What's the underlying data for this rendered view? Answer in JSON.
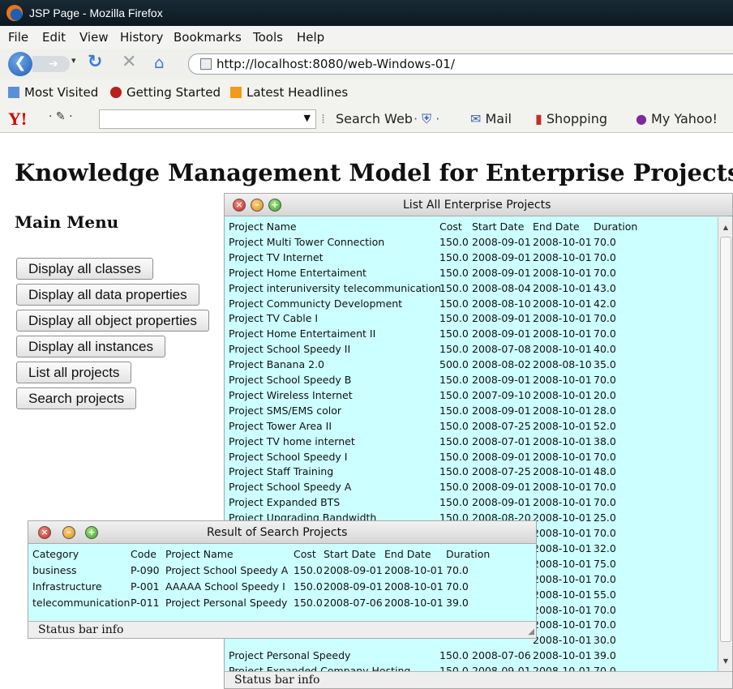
{
  "browser": {
    "window_title": "JSP Page - Mozilla Firefox",
    "menu": [
      "File",
      "Edit",
      "View",
      "History",
      "Bookmarks",
      "Tools",
      "Help"
    ],
    "url": "http://localhost:8080/web-Windows-01/",
    "bookmarks": [
      "Most Visited",
      "Getting Started",
      "Latest Headlines"
    ],
    "yahoo_toolbar": {
      "search_web": "Search Web",
      "mail": "Mail",
      "shopping": "Shopping",
      "my_yahoo": "My Yahoo!"
    }
  },
  "page": {
    "title": "Knowledge Management Model for Enterprise Projects",
    "main_menu_heading": "Main Menu",
    "menu_buttons": [
      "Display all classes",
      "Display all data properties",
      "Display all object properties",
      "Display all instances",
      "List all projects",
      "Search projects"
    ]
  },
  "list_window": {
    "title": "List All Enterprise Projects",
    "columns": [
      "Project Name",
      "Cost",
      "Start Date",
      "End Date",
      "Duration"
    ],
    "rows": [
      [
        "Project Multi Tower Connection",
        "150.0",
        "2008-09-01",
        "2008-10-01",
        "70.0"
      ],
      [
        "Project TV Internet",
        "150.0",
        "2008-09-01",
        "2008-10-01",
        "70.0"
      ],
      [
        "Project Home Entertaiment",
        "150.0",
        "2008-09-01",
        "2008-10-01",
        "70.0"
      ],
      [
        "Project interuniversity telecommunication",
        "150.0",
        "2008-08-04",
        "2008-10-01",
        "43.0"
      ],
      [
        "Project Communicty Development",
        "150.0",
        "2008-08-10",
        "2008-10-01",
        "42.0"
      ],
      [
        "Project TV Cable I",
        "150.0",
        "2008-09-01",
        "2008-10-01",
        "70.0"
      ],
      [
        "Project Home Entertaiment II",
        "150.0",
        "2008-09-01",
        "2008-10-01",
        "70.0"
      ],
      [
        "Project School Speedy II",
        "150.0",
        "2008-07-08",
        "2008-10-01",
        "40.0"
      ],
      [
        "Project Banana 2.0",
        "500.0",
        "2008-08-02",
        "2008-08-10",
        "35.0"
      ],
      [
        "Project School Speedy B",
        "150.0",
        "2008-09-01",
        "2008-10-01",
        "70.0"
      ],
      [
        "Project Wireless Internet",
        "150.0",
        "2007-09-10",
        "2008-10-01",
        "20.0"
      ],
      [
        "Project SMS/EMS color",
        "150.0",
        "2008-09-01",
        "2008-10-01",
        "28.0"
      ],
      [
        "Project Tower Area II",
        "150.0",
        "2008-07-25",
        "2008-10-01",
        "52.0"
      ],
      [
        "Project TV home internet",
        "150.0",
        "2008-07-01",
        "2008-10-01",
        "38.0"
      ],
      [
        "Project School Speedy I",
        "150.0",
        "2008-09-01",
        "2008-10-01",
        "70.0"
      ],
      [
        "Project Staff Training",
        "150.0",
        "2008-07-25",
        "2008-10-01",
        "48.0"
      ],
      [
        "Project School Speedy A",
        "150.0",
        "2008-09-01",
        "2008-10-01",
        "70.0"
      ],
      [
        "Project Expanded BTS",
        "150.0",
        "2008-09-01",
        "2008-10-01",
        "70.0"
      ],
      [
        "Project Upgrading Bandwidth",
        "150.0",
        "2008-08-20",
        "2008-10-01",
        "25.0"
      ],
      [
        "",
        "",
        "",
        "2008-10-01",
        "70.0"
      ],
      [
        "",
        "",
        "",
        "2008-10-01",
        "32.0"
      ],
      [
        "",
        "",
        "",
        "2008-10-01",
        "75.0"
      ],
      [
        "",
        "",
        "",
        "2008-10-01",
        "70.0"
      ],
      [
        "",
        "",
        "",
        "2008-10-01",
        "55.0"
      ],
      [
        "",
        "",
        "",
        "2008-10-01",
        "70.0"
      ],
      [
        "",
        "",
        "",
        "2008-10-01",
        "70.0"
      ],
      [
        "",
        "",
        "",
        "2008-10-01",
        "30.0"
      ],
      [
        "Project Personal Speedy",
        "150.0",
        "2008-07-06",
        "2008-10-01",
        "39.0"
      ],
      [
        "Project Expanded Company Hosting",
        "150.0",
        "2008-09-01",
        "2008-10-01",
        "70.0"
      ]
    ],
    "status": "Status bar info"
  },
  "search_window": {
    "title": "Result of Search Projects",
    "columns": [
      "Category",
      "Code",
      "Project Name",
      "Cost",
      "Start Date",
      "End Date",
      "Duration"
    ],
    "rows": [
      [
        "business",
        "P-090",
        "Project School Speedy A",
        "150.0",
        "2008-09-01",
        "2008-10-01",
        "70.0"
      ],
      [
        "Infrastructure",
        "P-001",
        "AAAAA School Speedy I",
        "150.0",
        "2008-09-01",
        "2008-10-01",
        "70.0"
      ],
      [
        "telecommunication",
        "P-011",
        "Project Personal Speedy",
        "150.0",
        "2008-07-06",
        "2008-10-01",
        "39.0"
      ]
    ],
    "status": "Status bar info"
  },
  "icons": {
    "firefox": "firefox-logo-icon",
    "back": "back-arrow-icon",
    "forward": "forward-arrow-icon",
    "reload": "reload-icon",
    "stop": "stop-icon",
    "home": "home-icon",
    "close": "close-icon",
    "minimize": "minimize-icon",
    "maximize": "maximize-icon"
  },
  "colors": {
    "window_bg": "#ccffff",
    "titlebar": "#1a2b36"
  }
}
